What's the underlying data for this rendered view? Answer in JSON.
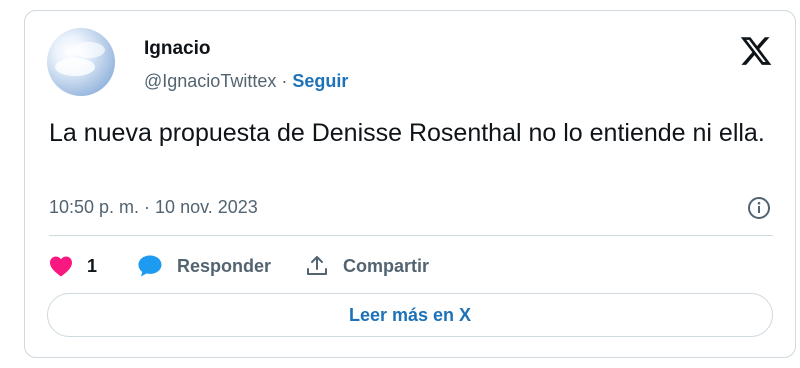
{
  "author": {
    "name": "Ignacio",
    "handle": "@IgnacioTwittex",
    "separator": " · ",
    "follow_label": "Seguir",
    "avatar_icon": "sky-clouds-avatar"
  },
  "brand": {
    "logo_icon": "x-logo-icon"
  },
  "tweet": {
    "text": "La nueva propuesta de Denisse Rosenthal no lo entiende ni ella.",
    "timestamp": "10:50 p. m. · 10 nov. 2023"
  },
  "actions": {
    "like_icon": "heart-icon",
    "like_count": "1",
    "reply_icon": "speech-bubble-icon",
    "reply_label": "Responder",
    "share_icon": "share-upload-icon",
    "share_label": "Compartir",
    "info_icon": "info-icon"
  },
  "footer": {
    "read_more_label": "Leer más en X"
  },
  "colors": {
    "accent": "#1d72b8",
    "like": "#f91880",
    "reply": "#1d9bf0",
    "muted": "#536471",
    "text": "#0f1419",
    "border": "#cfd9de"
  }
}
